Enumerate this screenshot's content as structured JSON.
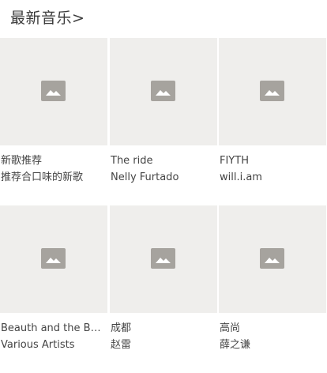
{
  "section": {
    "title": "最新音乐>"
  },
  "placeholder_icon": "image-placeholder-icon",
  "colors": {
    "cover_bg": "#efeeec",
    "icon": "#a6a39e"
  },
  "songs": [
    {
      "title": "新歌推荐",
      "subtitle": "推荐合口味的新歌"
    },
    {
      "title": "The ride",
      "subtitle": "Nelly Furtado"
    },
    {
      "title": "FIYTH",
      "subtitle": "will.i.am"
    },
    {
      "title": "Beauth and the Beast",
      "subtitle": "Various Artists"
    },
    {
      "title": "成都",
      "subtitle": "赵雷"
    },
    {
      "title": "高尚",
      "subtitle": "薛之谦"
    }
  ]
}
